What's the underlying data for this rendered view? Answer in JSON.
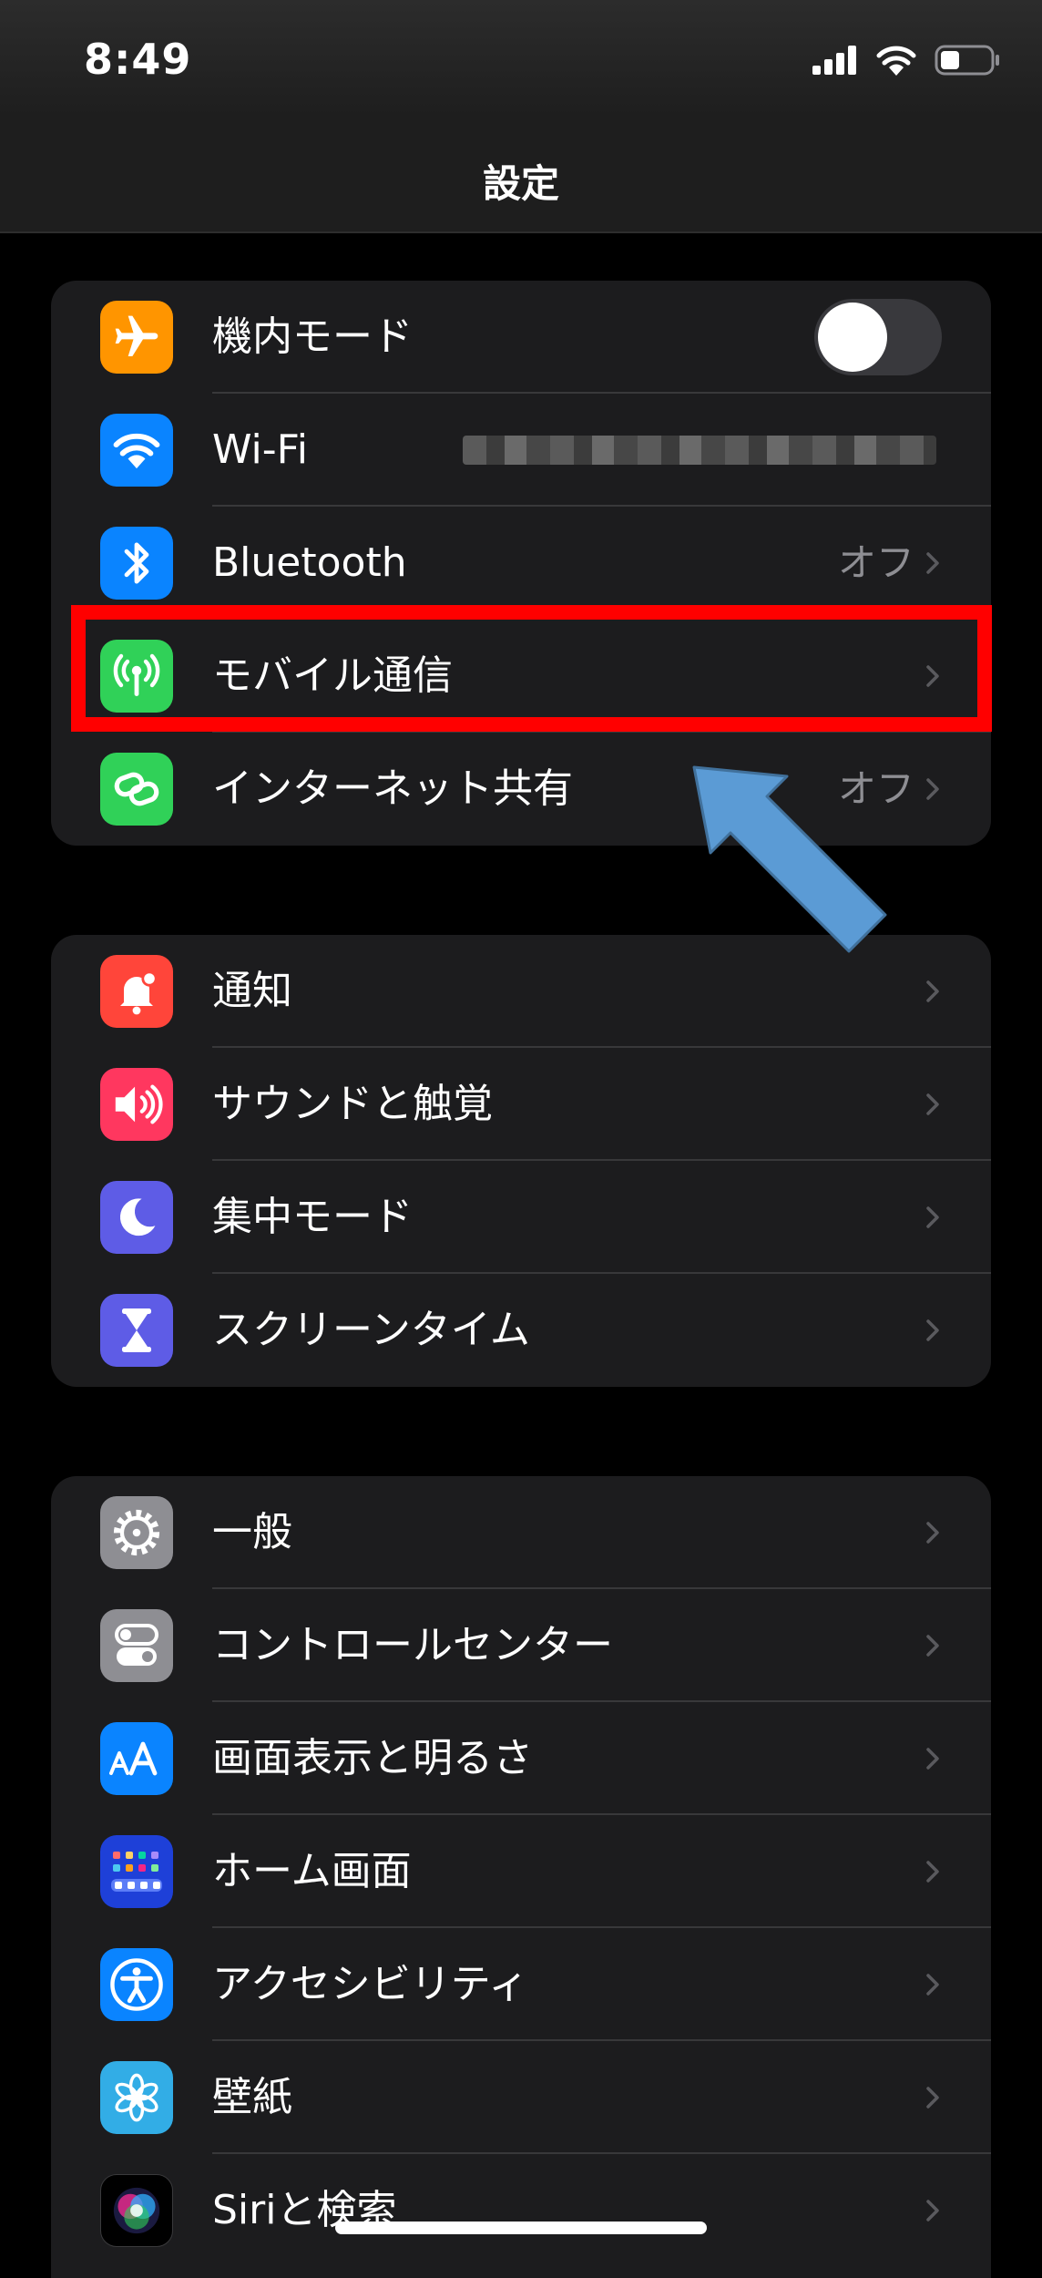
{
  "status_bar": {
    "time": "8:49"
  },
  "nav": {
    "title": "設定"
  },
  "group1": [
    {
      "label": "機内モード",
      "icon": "airplane-icon",
      "color": "#ff9500",
      "control": "toggle",
      "toggle_on": false
    },
    {
      "label": "Wi-Fi",
      "icon": "wifi-icon",
      "color": "#0a84ff",
      "control": "redacted"
    },
    {
      "label": "Bluetooth",
      "icon": "bluetooth-icon",
      "color": "#0a84ff",
      "value": "オフ"
    },
    {
      "label": "モバイル通信",
      "icon": "antenna-icon",
      "color": "#30d158"
    },
    {
      "label": "インターネット共有",
      "icon": "hotspot-link-icon",
      "color": "#30d158",
      "value": "オフ"
    }
  ],
  "group2": [
    {
      "label": "通知",
      "icon": "bell-icon",
      "color": "#ff453a"
    },
    {
      "label": "サウンドと触覚",
      "icon": "speaker-icon",
      "color": "#ff375f"
    },
    {
      "label": "集中モード",
      "icon": "moon-icon",
      "color": "#5e5ce6"
    },
    {
      "label": "スクリーンタイム",
      "icon": "hourglass-icon",
      "color": "#5e5ce6"
    }
  ],
  "group3": [
    {
      "label": "一般",
      "icon": "gear-icon",
      "color": "#8e8e93"
    },
    {
      "label": "コントロールセンター",
      "icon": "switches-icon",
      "color": "#8e8e93"
    },
    {
      "label": "画面表示と明るさ",
      "icon": "text-size-icon",
      "color": "#0a84ff"
    },
    {
      "label": "ホーム画面",
      "icon": "app-grid-icon",
      "color": "#1e40d8"
    },
    {
      "label": "アクセシビリティ",
      "icon": "accessibility-icon",
      "color": "#0a84ff"
    },
    {
      "label": "壁紙",
      "icon": "flower-icon",
      "color": "#32ade6"
    },
    {
      "label": "Siriと検索",
      "icon": "siri-icon",
      "color": "#1c1c1e"
    }
  ],
  "annotations": {
    "highlight_color": "#ff0000",
    "arrow_color": "#5b9bd5"
  }
}
